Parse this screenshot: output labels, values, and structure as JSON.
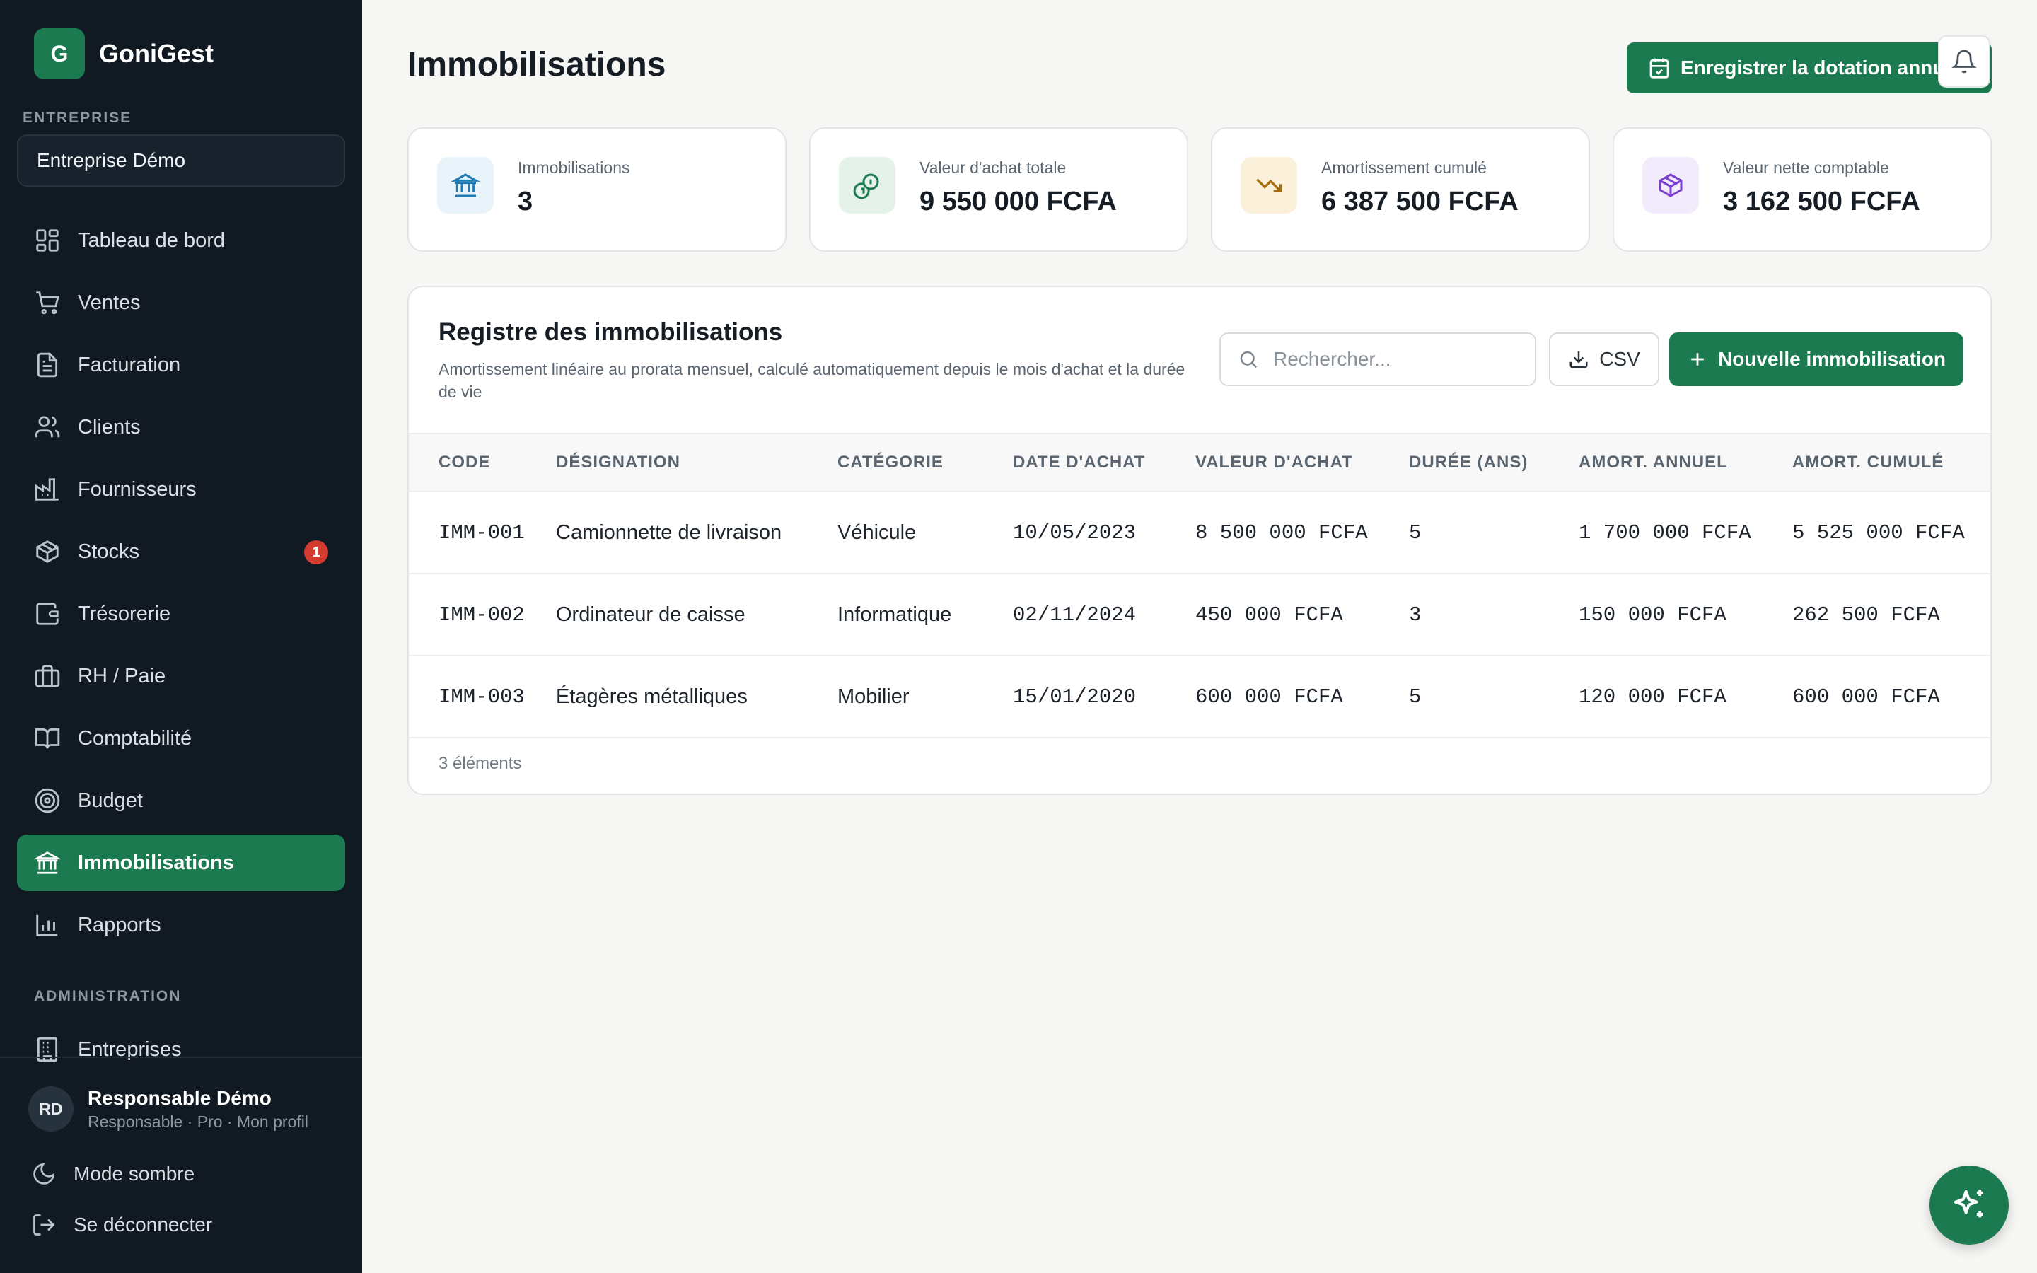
{
  "brand": {
    "initial": "G",
    "name": "GoniGest"
  },
  "sidebar": {
    "company_label": "ENTREPRISE",
    "company_value": "Entreprise Démo",
    "items": [
      {
        "label": "Tableau de bord",
        "icon": "dashboard-icon"
      },
      {
        "label": "Ventes",
        "icon": "cart-icon"
      },
      {
        "label": "Facturation",
        "icon": "document-icon"
      },
      {
        "label": "Clients",
        "icon": "users-icon"
      },
      {
        "label": "Fournisseurs",
        "icon": "factory-icon"
      },
      {
        "label": "Stocks",
        "icon": "package-icon",
        "badge": "1"
      },
      {
        "label": "Trésorerie",
        "icon": "wallet-icon"
      },
      {
        "label": "RH / Paie",
        "icon": "briefcase-icon"
      },
      {
        "label": "Comptabilité",
        "icon": "book-icon"
      },
      {
        "label": "Budget",
        "icon": "target-icon"
      },
      {
        "label": "Immobilisations",
        "icon": "bank-icon",
        "active": true
      },
      {
        "label": "Rapports",
        "icon": "bar-chart-icon"
      }
    ],
    "admin_label": "ADMINISTRATION",
    "admin_item": "Entreprises",
    "user": {
      "initials": "RD",
      "name": "Responsable Démo",
      "subtitle": "Responsable · Pro · Mon profil"
    },
    "dark_mode_label": "Mode sombre",
    "logout_label": "Se déconnecter"
  },
  "header": {
    "title": "Immobilisations",
    "primary_action": "Enregistrer la dotation annuelle"
  },
  "stats": [
    {
      "label": "Immobilisations",
      "value": "3",
      "icon": "bank-icon",
      "bg": "#e8f3fa",
      "fg": "#1d7ab3"
    },
    {
      "label": "Valeur d'achat totale",
      "value": "9 550 000 FCFA",
      "icon": "coins-icon",
      "bg": "#e4f2ea",
      "fg": "#1b7a4f"
    },
    {
      "label": "Amortissement cumulé",
      "value": "6 387 500 FCFA",
      "icon": "trending-down-icon",
      "bg": "#fbf0d9",
      "fg": "#a86d0c"
    },
    {
      "label": "Valeur nette comptable",
      "value": "3 162 500 FCFA",
      "icon": "box-icon",
      "bg": "#f1ebfb",
      "fg": "#7a3fd0"
    }
  ],
  "register": {
    "title": "Registre des immobilisations",
    "subtitle": "Amortissement linéaire au prorata mensuel, calculé automatiquement depuis le mois d'achat et la durée de vie",
    "search_placeholder": "Rechercher...",
    "csv_label": "CSV",
    "new_label": "Nouvelle immobilisation",
    "columns": [
      "CODE",
      "DÉSIGNATION",
      "CATÉGORIE",
      "DATE D'ACHAT",
      "VALEUR D'ACHAT",
      "DURÉE (ANS)",
      "AMORT. ANNUEL",
      "AMORT. CUMULÉ"
    ],
    "rows": [
      [
        "IMM-001",
        "Camionnette de livraison",
        "Véhicule",
        "10/05/2023",
        "8 500 000 FCFA",
        "5",
        "1 700 000 FCFA",
        "5 525 000 FCFA"
      ],
      [
        "IMM-002",
        "Ordinateur de caisse",
        "Informatique",
        "02/11/2024",
        "450 000 FCFA",
        "3",
        "150 000 FCFA",
        "262 500 FCFA"
      ],
      [
        "IMM-003",
        "Étagères métalliques",
        "Mobilier",
        "15/01/2020",
        "600 000 FCFA",
        "5",
        "120 000 FCFA",
        "600 000 FCFA"
      ]
    ],
    "footer": "3 éléments"
  },
  "colors": {
    "accent": "#1b7a4f",
    "sidebar_bg": "#111a22",
    "badge": "#d23b2e"
  }
}
